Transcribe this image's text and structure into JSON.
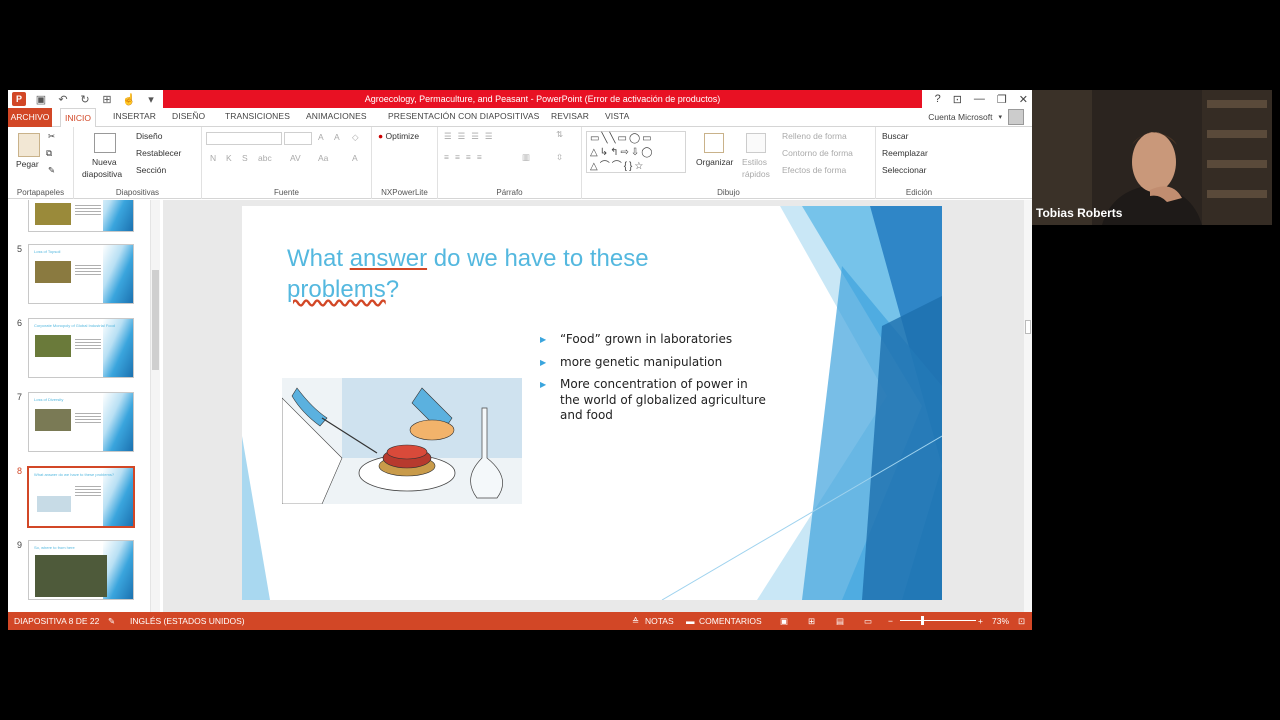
{
  "window": {
    "title": "Agroecology, Permaculture, and Peasant - PowerPoint (Error de activación de productos)",
    "help": "?",
    "account": "Cuenta Microsoft"
  },
  "tabs": {
    "archivo": "ARCHIVO",
    "inicio": "INICIO",
    "insertar": "INSERTAR",
    "diseno": "DISEÑO",
    "transiciones": "TRANSICIONES",
    "animaciones": "ANIMACIONES",
    "presentacion": "PRESENTACIÓN CON DIAPOSITIVAS",
    "revisar": "REVISAR",
    "vista": "VISTA"
  },
  "ribbon": {
    "pegar": "Pegar",
    "portapapeles": "Portapapeles",
    "nueva": "Nueva",
    "diapositiva": "diapositiva",
    "diseno": "Diseño",
    "restablecer": "Restablecer",
    "seccion": "Sección",
    "diapositivas": "Diapositivas",
    "fuente": "Fuente",
    "optimize": "Optimize",
    "nxpowerlite": "NXPowerLite",
    "parrafo": "Párrafo",
    "organizar": "Organizar",
    "estilos": "Estilos",
    "rapidos": "rápidos",
    "relleno": "Relleno de forma",
    "contorno": "Contorno de forma",
    "efectos": "Efectos de forma",
    "dibujo": "Dibujo",
    "buscar": "Buscar",
    "reemplazar": "Reemplazar",
    "seleccionar": "Seleccionar",
    "edicion": "Edición",
    "font_buttons": [
      "N",
      "K",
      "S",
      "abc",
      "AV",
      "Aa",
      "A"
    ]
  },
  "thumbnails": [
    {
      "num": "5",
      "title": "Loss of Topsoil"
    },
    {
      "num": "6",
      "title": "Corporate Monopoly of Global Industrial Food"
    },
    {
      "num": "7",
      "title": "Loss of Diversity"
    },
    {
      "num": "8",
      "title": "What answer do we have to these problems?"
    },
    {
      "num": "9",
      "title": "So, where to from here"
    }
  ],
  "slide": {
    "title_part1": "What ",
    "title_answer": "answer",
    "title_part2": " do we have to these",
    "title_problems": "problems",
    "title_q": "?",
    "bullets": [
      "“Food” grown in laboratories",
      "more genetic manipulation",
      "More concentration of power in the world of globalized agriculture and food"
    ]
  },
  "status": {
    "slide_of": "DIAPOSITIVA 8 DE 22",
    "language": "INGLÉS (ESTADOS UNIDOS)",
    "notas": "NOTAS",
    "comentarios": "COMENTARIOS",
    "zoom": "73%"
  },
  "video": {
    "name": "Tobias Roberts"
  },
  "colors": {
    "accent": "#d24726",
    "title_bar": "#e81123",
    "slide_title": "#54b8df"
  }
}
